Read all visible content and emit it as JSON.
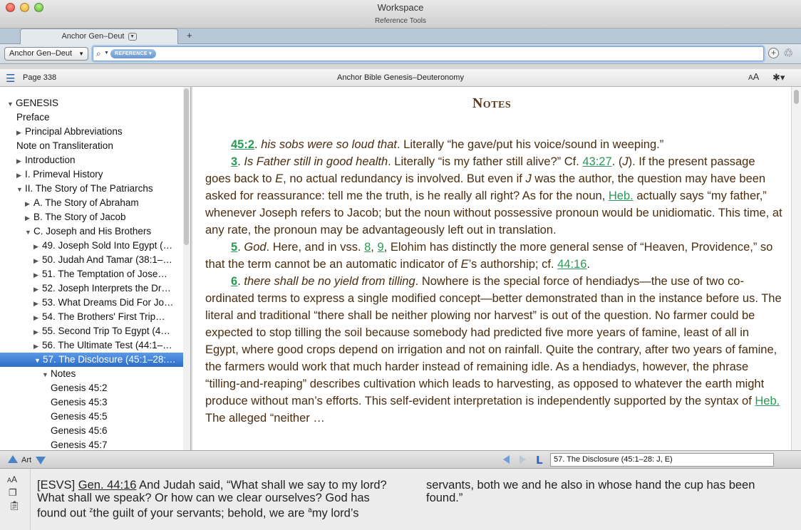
{
  "window": {
    "title": "Workspace",
    "subtitle": "Reference Tools"
  },
  "tab": {
    "label": "Anchor Gen–Deut",
    "add_label": "+"
  },
  "search": {
    "resource_select": "Anchor Gen–Deut",
    "mode_pill": "REFERENCE",
    "value": ""
  },
  "panel": {
    "page_label": "Page 338",
    "resource_title": "Anchor Bible Genesis–Deuteronomy",
    "text_size_large": "A",
    "text_size_small": "A"
  },
  "toc": {
    "items": [
      {
        "label": "GENESIS",
        "tri": "▼"
      },
      {
        "label": "Preface",
        "tri": ""
      },
      {
        "label": "Principal Abbreviations",
        "tri": "▶"
      },
      {
        "label": "Note on Transliteration",
        "tri": ""
      },
      {
        "label": "Introduction",
        "tri": "▶"
      },
      {
        "label": "I. Primeval History",
        "tri": "▶"
      },
      {
        "label": "II. The Story of The Patriarchs",
        "tri": "▼"
      },
      {
        "label": "A. The Story of Abraham",
        "tri": "▶"
      },
      {
        "label": "B. The Story of Jacob",
        "tri": "▶"
      },
      {
        "label": "C. Joseph and His Brothers",
        "tri": "▼"
      },
      {
        "label": "49. Joseph Sold Into Egypt (…",
        "tri": "▶"
      },
      {
        "label": "50. Judah And Tamar (38:1–…",
        "tri": "▶"
      },
      {
        "label": "51. The Temptation of Jose…",
        "tri": "▶"
      },
      {
        "label": "52. Joseph Interprets the Dr…",
        "tri": "▶"
      },
      {
        "label": "53. What Dreams Did For Jo…",
        "tri": "▶"
      },
      {
        "label": "54. The Brothers' First Trip…",
        "tri": "▶"
      },
      {
        "label": "55. Second Trip To Egypt (4…",
        "tri": "▶"
      },
      {
        "label": "56. The Ultimate Test (44:1–…",
        "tri": "▶"
      },
      {
        "label": "57. The Disclosure (45:1–28:…",
        "tri": "▼"
      },
      {
        "label": "Notes",
        "tri": "▼"
      },
      {
        "label": "Genesis 45:2",
        "tri": ""
      },
      {
        "label": "Genesis  45:3",
        "tri": ""
      },
      {
        "label": "Genesis  45:5",
        "tri": ""
      },
      {
        "label": "Genesis  45:6",
        "tri": ""
      },
      {
        "label": "Genesis  45:7",
        "tri": ""
      }
    ]
  },
  "reader": {
    "heading": "Notes",
    "p1": {
      "ref": "45:2",
      "lemma": "his sobs were so loud that",
      "text": ". Literally “he gave/put his voice/sound in weeping.”"
    },
    "p2": {
      "num": "3",
      "lemma": "Is Father still in good health",
      "t1": ". Literally “is my father still alive?” Cf. ",
      "ref1": "43:27",
      "t2": ". (",
      "j1": "J",
      "t3": "). If the present passage goes back to ",
      "e1": "E",
      "t4": ", no actual redundancy is involved. But even if ",
      "j2": "J",
      "t5": " was the author, the question may have been asked for reassurance: tell me the truth, is he really all right? As for the noun, ",
      "heb": "Heb.",
      "t6": " actually says “my father,” whenever Joseph refers to Jacob; but the noun without possessive pronoun would be unidiomatic. This time, at any rate, the pronoun may be advantageously left out in translation."
    },
    "p3": {
      "num": "5",
      "lemma": "God",
      "t1": ". Here, and in vss. ",
      "ref1": "8",
      "t2": ", ",
      "ref2": "9",
      "t3": ", Elohim has distinctly the more general sense of “Heaven, Providence,” so that the term cannot be an automatic indicator of ",
      "e1": "E",
      "t4": "’s authorship; cf. ",
      "ref3": "44:16",
      "t5": "."
    },
    "p4": {
      "num": "6",
      "lemma": "there shall be no yield from tilling",
      "t1": ". Nowhere is the special force of hendiadys—the use of two co-ordinated terms to express a single modified concept—better demonstrated than in the instance before us. The literal and traditional “there shall be neither plowing nor harvest” is out of the question. No farmer could be expected to stop tilling the soil because somebody had predicted five more years of famine, least of all in Egypt, where good crops depend on irrigation and not on rainfall. Quite the contrary, after two years of famine, the farmers would work that much harder instead of remaining idle. As a hendiadys, however, the phrase “tilling-and-reaping” describes cultivation which leads to harvesting, as opposed to whatever the earth might produce without man’s efforts. This self-evident interpretation is independently supported by the syntax of ",
      "heb": "Heb.",
      "t2": " The alleged “neither …"
    }
  },
  "bottombar": {
    "art_label": "Art",
    "location": "57. The Disclosure (45:1–28: J, E)"
  },
  "preview": {
    "tag": "[ESVS]",
    "ref": "Gen. 44:16",
    "t1": " And Judah said, “What shall we say to my lord? What shall we speak? Or how can we clear ourselves? God has found out ",
    "sup1": "z",
    "t2": "the guilt of your servants; behold, we are ",
    "sup2": "a",
    "t3": "my lord’s servants, both we and he also in whose hand the cup has been found.”"
  },
  "colors": {
    "link_green": "#2a9a55",
    "body_brown": "#4a2e10",
    "selection_blue": "#2d6cc9"
  }
}
